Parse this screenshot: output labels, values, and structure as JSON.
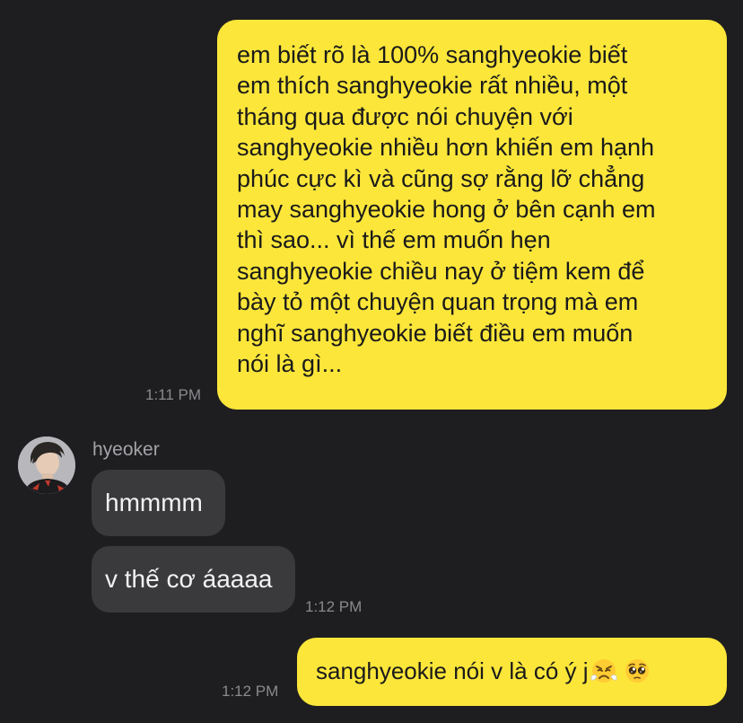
{
  "messages": [
    {
      "direction": "outgoing",
      "text": "em biết rõ là 100% sanghyeokie biết\nem thích sanghyeokie rất nhiều, một\ntháng qua được nói chuyện với\nsanghyeokie nhiều hơn khiến em hạnh\nphúc cực kì và cũng sợ rằng lỡ chẳng\nmay sanghyeokie hong ở bên cạnh em\nthì sao... vì thế em muốn hẹn\nsanghyeokie chiều nay ở tiệm kem để\nbày tỏ một chuyện quan trọng mà em\nnghĩ sanghyeokie biết điều em muốn\nnói là gì...",
      "time": "1:11 PM"
    },
    {
      "direction": "incoming",
      "sender": "hyeoker",
      "text": "hmmmm"
    },
    {
      "direction": "incoming",
      "text": "v thế cơ áaaaa",
      "time": "1:12 PM"
    },
    {
      "direction": "outgoing",
      "text": "sanghyeokie nói v là có ý j",
      "emojis": [
        "steam-from-nose-emoji",
        "pleading-face-emoji"
      ],
      "time": "1:12 PM"
    }
  ],
  "colors": {
    "background": "#1e1e20",
    "outgoing_bubble": "#fce63a",
    "incoming_bubble": "#3a3a3d",
    "timestamp": "#8a8a8e"
  }
}
